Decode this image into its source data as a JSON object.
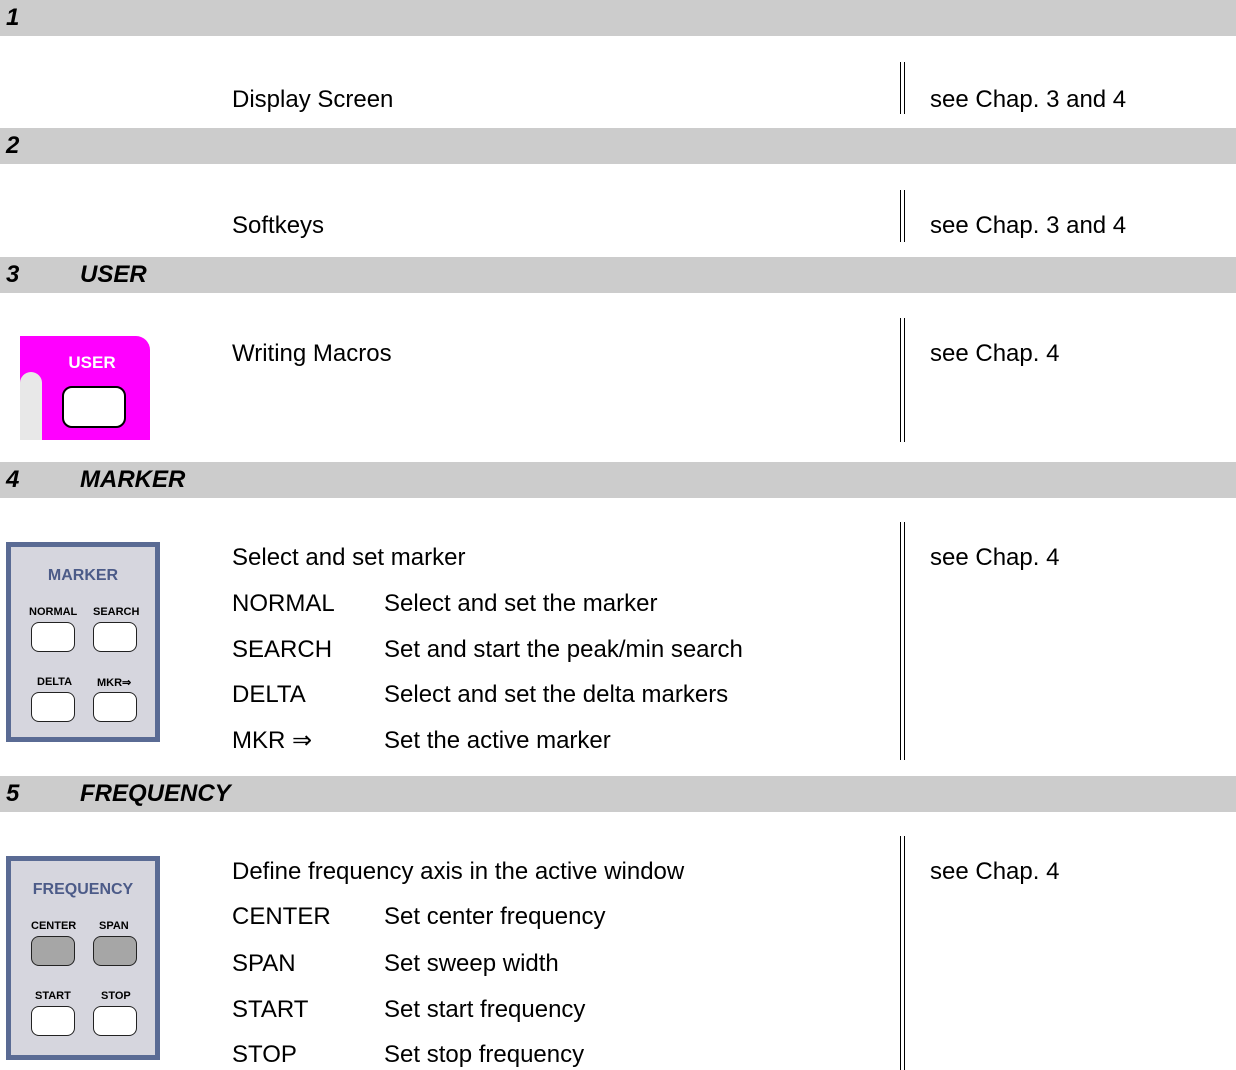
{
  "sections": [
    {
      "number": "1",
      "title": "",
      "description": "Display Screen",
      "reference": "see Chap. 3 and 4",
      "keys": []
    },
    {
      "number": "2",
      "title": "",
      "description": "Softkeys",
      "reference": "see Chap. 3 and 4",
      "keys": []
    },
    {
      "number": "3",
      "title": "USER",
      "description": "Writing Macros",
      "reference": "see Chap. 4",
      "panel_label": "USER",
      "keys": []
    },
    {
      "number": "4",
      "title": "MARKER",
      "description": "Select and set marker",
      "reference": "see Chap. 4",
      "panel_title": "MARKER",
      "panel_keys": [
        "NORMAL",
        "SEARCH",
        "DELTA",
        "MKR⇒"
      ],
      "keys": [
        {
          "name": "NORMAL",
          "desc": "Select and set the marker"
        },
        {
          "name": "SEARCH",
          "desc": "Set and start the peak/min search"
        },
        {
          "name": "DELTA",
          "desc": "Select and set the delta markers"
        },
        {
          "name": "MKR ⇒",
          "desc": "Set the active marker"
        }
      ]
    },
    {
      "number": "5",
      "title": "FREQUENCY",
      "description": "Define frequency axis in the active window",
      "reference": "see Chap. 4",
      "panel_title": "FREQUENCY",
      "panel_keys": [
        "CENTER",
        "SPAN",
        "START",
        "STOP"
      ],
      "keys": [
        {
          "name": "CENTER",
          "desc": "Set center frequency"
        },
        {
          "name": "SPAN",
          "desc": "Set sweep width"
        },
        {
          "name": "START",
          "desc": "Set start frequency"
        },
        {
          "name": "STOP",
          "desc": "Set stop frequency"
        }
      ]
    }
  ],
  "colors": {
    "header_bg": "#cccccc",
    "user_key_magenta": "#ff00ff",
    "panel_border": "#5a6b94",
    "panel_bg": "#d6d6de"
  }
}
